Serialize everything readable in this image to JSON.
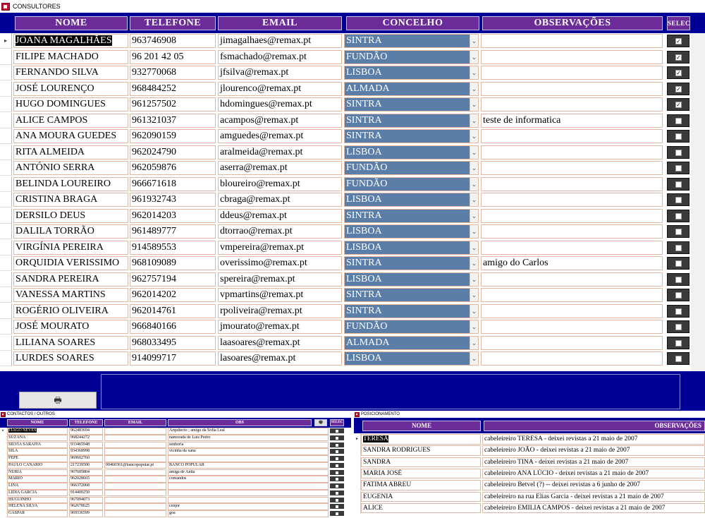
{
  "consultores": {
    "title": "CONSULTORES",
    "headers": {
      "nome": "NOME",
      "telefone": "TELEFONE",
      "email": "EMAIL",
      "concelho": "CONCELHO",
      "obs": "OBSERVAÇÕES",
      "selec": "SELEC"
    },
    "print_icon": "printer-icon",
    "rows": [
      {
        "nome": "JOANA MAGALHÃES",
        "telefone": "963746908",
        "email": "jimagalhaes@remax.pt",
        "concelho": "SINTRA",
        "obs": "",
        "selected": true
      },
      {
        "nome": "FILIPE MACHADO",
        "telefone": "96 201 42 05",
        "email": "fsmachado@remax.pt",
        "concelho": "FUNDÃO",
        "obs": "",
        "selected": true
      },
      {
        "nome": "FERNANDO SILVA",
        "telefone": "932770068",
        "email": "jfsilva@remax.pt",
        "concelho": "LISBOA",
        "obs": "",
        "selected": true
      },
      {
        "nome": "JOSÉ LOURENÇO",
        "telefone": "968484252",
        "email": "jlourenco@remax.pt",
        "concelho": "ALMADA",
        "obs": "",
        "selected": true
      },
      {
        "nome": "HUGO DOMINGUES",
        "telefone": "961257502",
        "email": "hdomingues@remax.pt",
        "concelho": "SINTRA",
        "obs": "",
        "selected": true
      },
      {
        "nome": "ALICE CAMPOS",
        "telefone": "961321037",
        "email": "acampos@remax.pt",
        "concelho": "SINTRA",
        "obs": "teste de informatica",
        "selected": false
      },
      {
        "nome": "ANA MOURA GUEDES",
        "telefone": "962090159",
        "email": "amguedes@remax.pt",
        "concelho": "SINTRA",
        "obs": "",
        "selected": false
      },
      {
        "nome": "RITA ALMEIDA",
        "telefone": "962024790",
        "email": "aralmeida@remax.pt",
        "concelho": "LISBOA",
        "obs": "",
        "selected": false
      },
      {
        "nome": "ANTÓNIO SERRA",
        "telefone": "962059876",
        "email": "aserra@remax.pt",
        "concelho": "FUNDÃO",
        "obs": "",
        "selected": false
      },
      {
        "nome": "BELINDA LOUREIRO",
        "telefone": "966671618",
        "email": "bloureiro@remax.pt",
        "concelho": "FUNDÃO",
        "obs": "",
        "selected": false
      },
      {
        "nome": "CRISTINA BRAGA",
        "telefone": "961932743",
        "email": "cbraga@remax.pt",
        "concelho": "LISBOA",
        "obs": "",
        "selected": false
      },
      {
        "nome": "DERSILO DEUS",
        "telefone": "962014203",
        "email": "ddeus@remax.pt",
        "concelho": "SINTRA",
        "obs": "",
        "selected": false
      },
      {
        "nome": "DALILA TORRÃO",
        "telefone": "961489777",
        "email": "dtorrao@remax.pt",
        "concelho": "LISBOA",
        "obs": "",
        "selected": false
      },
      {
        "nome": "VIRGÍNIA PEREIRA",
        "telefone": "914589553",
        "email": "vmpereira@remax.pt",
        "concelho": "LISBOA",
        "obs": "",
        "selected": false
      },
      {
        "nome": "ORQUIDIA VERISSIMO",
        "telefone": "968109089",
        "email": "overissimo@remax.pt",
        "concelho": "SINTRA",
        "obs": "amigo do Carlos",
        "selected": false
      },
      {
        "nome": "SANDRA PEREIRA",
        "telefone": "962757194",
        "email": "spereira@remax.pt",
        "concelho": "LISBOA",
        "obs": "",
        "selected": false
      },
      {
        "nome": "VANESSA MARTINS",
        "telefone": "962014202",
        "email": "vpmartins@remax.pt",
        "concelho": "SINTRA",
        "obs": "",
        "selected": false
      },
      {
        "nome": "ROGÉRIO OLIVEIRA",
        "telefone": "962014761",
        "email": "rpoliveira@remax.pt",
        "concelho": "SINTRA",
        "obs": "",
        "selected": false
      },
      {
        "nome": "JOSÉ MOURATO",
        "telefone": "966840166",
        "email": "jmourato@remax.pt",
        "concelho": "FUNDÃO",
        "obs": "",
        "selected": false
      },
      {
        "nome": "LILIANA SOARES",
        "telefone": "968033495",
        "email": "laasoares@remax.pt",
        "concelho": "ALMADA",
        "obs": "",
        "selected": false
      },
      {
        "nome": "LURDES SOARES",
        "telefone": "914099717",
        "email": "lasoares@remax.pt",
        "concelho": "LISBOA",
        "obs": "",
        "selected": false
      }
    ]
  },
  "contactos": {
    "title": "CONTACTOS / OUTROS",
    "headers": {
      "nome": "NOME",
      "telefone": "TELEFONE",
      "email": "EMAIL",
      "obs": "OBS",
      "selec": "SELEC"
    },
    "rows": [
      {
        "nome": "TIAGO NEVES",
        "telefone": "962483694",
        "email": "",
        "obs": "Arquitecto ; amigo da Sofia Leal"
      },
      {
        "nome": "SUZANA",
        "telefone": "968244272",
        "email": "",
        "obs": "namorada de Luis Pedro"
      },
      {
        "nome": "SILVIA SARAIVA",
        "telefone": "933465948",
        "email": "",
        "obs": "senhoria"
      },
      {
        "nome": "SILA",
        "telefone": "934368998",
        "email": "",
        "obs": "vicinha da xana"
      },
      {
        "nome": "PEPE",
        "telefone": "969602760",
        "email": "",
        "obs": ""
      },
      {
        "nome": "PAULO CANÁRIO",
        "telefone": "217239500",
        "email": "00460361@bancopopular.pt",
        "obs": "BANCO POPULAR"
      },
      {
        "nome": "NURIA",
        "telefone": "967605804",
        "email": "",
        "obs": "amiga de Anita"
      },
      {
        "nome": "MARIO",
        "telefone": "962028665",
        "email": "",
        "obs": "comandos"
      },
      {
        "nome": "LINA",
        "telefone": "966372068",
        "email": "",
        "obs": ""
      },
      {
        "nome": "LIDIA GARCIA",
        "telefone": "914400250",
        "email": "",
        "obs": ""
      },
      {
        "nome": "HUGUINHO",
        "telefone": "967094073",
        "email": "",
        "obs": ""
      },
      {
        "nome": "HELENA SILVA",
        "telefone": "962678625",
        "email": "",
        "obs": "cenjor"
      },
      {
        "nome": "GASPAR",
        "telefone": "969336599",
        "email": "",
        "obs": "goa"
      }
    ]
  },
  "posicionamento": {
    "title": "POSICIONAMENTO",
    "headers": {
      "nome": "NOME",
      "obs": "OBSERVAÇÕES"
    },
    "rows": [
      {
        "nome": "TERESA",
        "obs": "cabeleireiro TERESA - deixei revistas a 21 maio de 2007"
      },
      {
        "nome": "SANDRA RODRIGUES",
        "obs": "cabeleireiro JOÃO - deixei revistas a 21 maio de 2007"
      },
      {
        "nome": "SANDRA",
        "obs": "cabeleireiro TINA - deixei revistas a 21 maio de 2007"
      },
      {
        "nome": "MARIA JOSÉ",
        "obs": "cabeleireiro ANA LÚCIO  - deixei revistas a 21 maio de 2007"
      },
      {
        "nome": "FATIMA ABREU",
        "obs": "cabeleireiro Betvel (?) -- deixei revistas a 6 junho de 2007"
      },
      {
        "nome": "EUGENIA",
        "obs": "cabeleireiro na rua Elias Garcia - deixei revistas a 21 maio de 2007"
      },
      {
        "nome": "ALICE",
        "obs": "cabeleireiro EMILIA CAMPOS - deixei revistas a 21 maio de 2007"
      }
    ]
  }
}
